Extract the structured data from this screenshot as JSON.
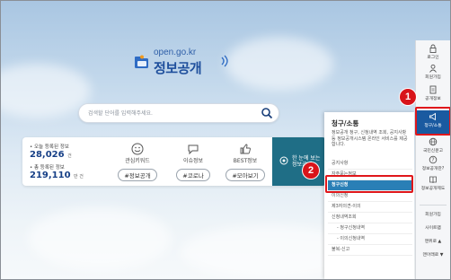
{
  "logo": {
    "domain": "open.go.kr",
    "title": "정보공개"
  },
  "search": {
    "placeholder": "검색할 단어를 입력해주세요."
  },
  "stats": {
    "today_label": "오늘 등록된 정보",
    "today_value": "28,026",
    "today_unit": "건",
    "total_label": "총 등록된 정보",
    "total_value": "219,110",
    "total_unit": "만 건"
  },
  "features": [
    {
      "label": "관심키워드",
      "tag": "#정보공개",
      "icon": "smile-icon"
    },
    {
      "label": "이슈정보",
      "tag": "#코로나",
      "icon": "chat-icon"
    },
    {
      "label": "BEST정보",
      "tag": "#모아보기",
      "icon": "thumbs-up-icon"
    }
  ],
  "teal_card": {
    "line1": "한 눈에 보는",
    "line2": "정보공개"
  },
  "panel": {
    "title": "청구/소통",
    "description": "정보공개 청구, 신청내역 조회, 공지사항 등 정보공개시스템 온라인 서비스를 제공합니다.",
    "menu": [
      {
        "label": "공지사항",
        "type": "item"
      },
      {
        "label": "자주묻는정보",
        "type": "item"
      },
      {
        "label": "청구신청",
        "type": "highlight"
      },
      {
        "label": "이의신청",
        "type": "item"
      },
      {
        "label": "제3자의견-이의",
        "type": "item"
      },
      {
        "label": "신청내역조회",
        "type": "item"
      },
      {
        "label": "- 청구신청내역",
        "type": "sub"
      },
      {
        "label": "- 이의신청내역",
        "type": "sub"
      },
      {
        "label": "불복-신고",
        "type": "item"
      }
    ]
  },
  "sidebar": {
    "items": [
      {
        "label": "로그인",
        "icon": "lock-icon"
      },
      {
        "label": "회원가입",
        "icon": "user-icon"
      },
      {
        "label": "공개정보",
        "icon": "document-icon"
      },
      {
        "label": "청구/소통",
        "icon": "megaphone-icon",
        "active": true
      },
      {
        "label": "국민신문고",
        "icon": "globe-icon"
      },
      {
        "label": "정보공개란?",
        "icon": "question-icon"
      },
      {
        "label": "정보공개제도",
        "icon": "book-icon"
      },
      {
        "label": "회원가입",
        "icon": "",
        "plain": true
      },
      {
        "label": "사이트맵",
        "icon": "",
        "plain": true
      },
      {
        "label": "맨위로",
        "icon": "arrow-up-icon",
        "plain": true
      },
      {
        "label": "맨아래로",
        "icon": "arrow-down-icon",
        "plain": true
      }
    ]
  },
  "annotations": {
    "badge1": "1",
    "badge2": "2"
  },
  "colors": {
    "accent": "#1a5aa0",
    "teal": "#1f6e86",
    "highlight": "#2a7fb6",
    "annotation_red": "#e0171b"
  }
}
